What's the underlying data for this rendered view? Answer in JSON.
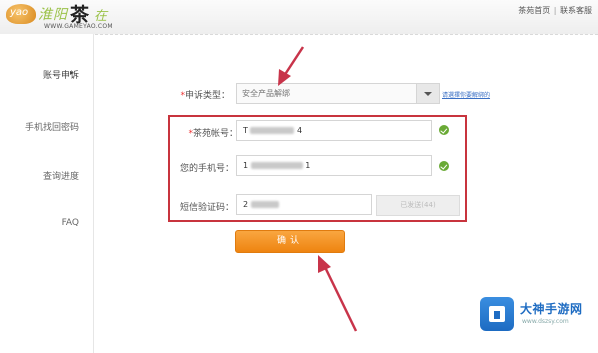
{
  "header": {
    "logo_text": "yao",
    "logo_leaf": "淮阳",
    "logo_char": "茶",
    "logo_tail": "在",
    "logo_url": "WWW.GAMEYAO.COM",
    "links": [
      "茶苑首页",
      "联系客服"
    ],
    "separator": "|"
  },
  "sidebar": {
    "items": [
      {
        "label": "账号申诉",
        "active": true,
        "caret": "▸"
      },
      {
        "label": "手机找回密码",
        "active": false
      },
      {
        "label": "查询进度",
        "active": false
      },
      {
        "label": "FAQ",
        "active": false
      }
    ]
  },
  "form": {
    "appeal_type": {
      "label": "申诉类型：",
      "value": "安全产品解绑",
      "link": "请選擇你要解绑的"
    },
    "account": {
      "label": "茶苑帐号：",
      "required": "*",
      "value_start": "T",
      "value_end": "4"
    },
    "phone": {
      "label": "您的手机号：",
      "value_start": "1",
      "value_end": "1"
    },
    "sms_code": {
      "label": "短信验证码：",
      "value_start": "2"
    },
    "get_code_button": "已发送(44)",
    "confirm_button": "确认"
  },
  "watermark": {
    "title": "大神手游网",
    "url": "www.dszsy.com"
  },
  "colors": {
    "highlight": "#c8343d",
    "confirm": "#f39a2c",
    "ok": "#6aaa36",
    "link": "#3a6fc4"
  }
}
